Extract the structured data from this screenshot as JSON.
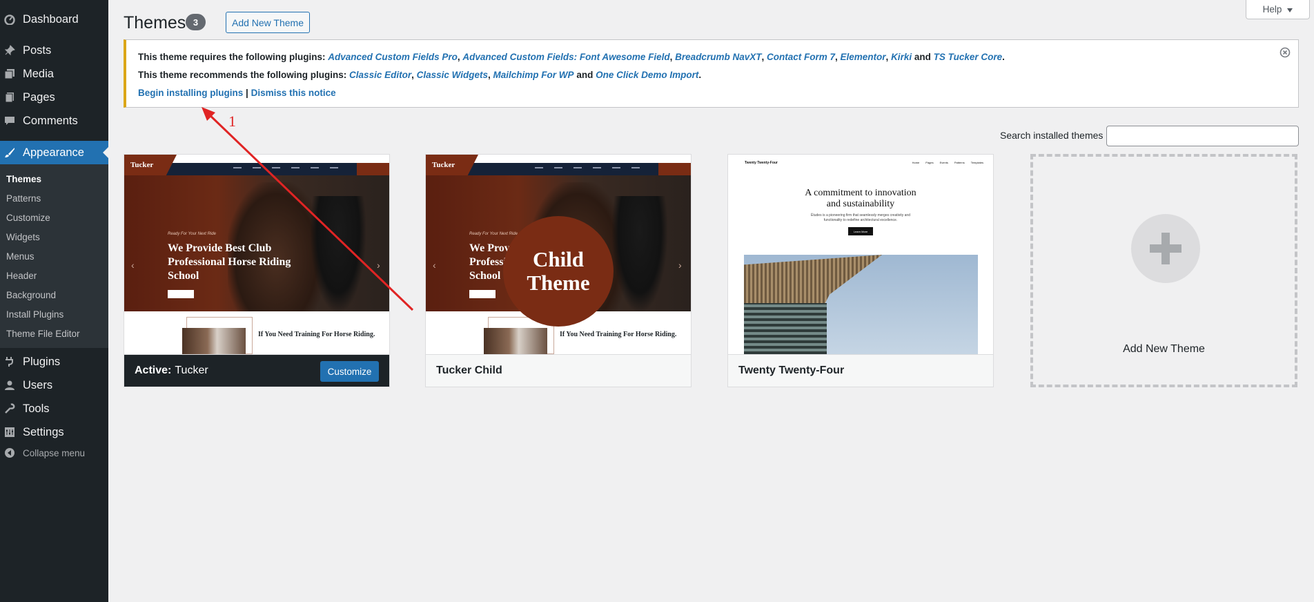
{
  "sidebar": {
    "dashboard": "Dashboard",
    "posts": "Posts",
    "media": "Media",
    "pages": "Pages",
    "comments": "Comments",
    "appearance": "Appearance",
    "submenu": [
      "Themes",
      "Patterns",
      "Customize",
      "Widgets",
      "Menus",
      "Header",
      "Background",
      "Install Plugins",
      "Theme File Editor"
    ],
    "plugins": "Plugins",
    "users": "Users",
    "tools": "Tools",
    "settings": "Settings",
    "collapse": "Collapse menu"
  },
  "header": {
    "title": "Themes",
    "count": "3",
    "add_new": "Add New Theme",
    "help": "Help"
  },
  "notice": {
    "required_prefix": "This theme requires the following plugins:",
    "required": [
      "Advanced Custom Fields Pro",
      "Advanced Custom Fields: Font Awesome Field",
      "Breadcrumb NavXT",
      "Contact Form 7",
      "Elementor",
      "Kirki",
      "TS Tucker Core"
    ],
    "recommended_prefix": "This theme recommends the following plugins:",
    "recommended": [
      "Classic Editor",
      "Classic Widgets",
      "Mailchimp For WP",
      "One Click Demo Import"
    ],
    "and": "and",
    "begin": "Begin installing plugins",
    "sep": "|",
    "dismiss": "Dismiss this notice"
  },
  "search": {
    "label": "Search installed themes",
    "value": ""
  },
  "themes": {
    "active_prefix": "Active:",
    "active_name": "Tucker",
    "customize": "Customize",
    "child_name": "Tucker Child",
    "tt4_name": "Twenty Twenty-Four",
    "add_new": "Add New Theme"
  },
  "previews": {
    "tucker_logo": "Tucker",
    "tucker_kicker": "Ready For Your Next Ride",
    "tucker_headline": "We Provide Best Club Professional Horse Riding School",
    "tucker_child_headline": "We Provide Best Club Professional Horse Riding School",
    "tucker_section": "If You Need Training For Horse Riding.",
    "child_badge_line1": "Child",
    "child_badge_line2": "Theme",
    "tt4_logo": "Twenty Twenty-Four",
    "tt4_nav": [
      "Home",
      "Pages",
      "Events",
      "Patterns",
      "Templates"
    ],
    "tt4_headline": "A commitment to innovation and sustainability",
    "tt4_sub": "Études is a pioneering firm that seamlessly merges creativity and functionality to redefine architectural excellence.",
    "tt4_button": "Learn More"
  },
  "annotation": {
    "number": "1",
    "color": "#e02424"
  },
  "colors": {
    "sidebar": "#1d2327",
    "accent": "#2271b1",
    "notice_border": "#dba617",
    "tucker_brand": "#7a2c14"
  }
}
